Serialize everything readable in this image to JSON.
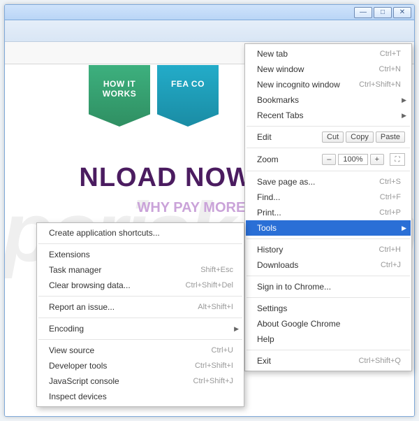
{
  "watermark": "pcrisk.com",
  "ribbons": {
    "how_it_works": "HOW IT\nWORKS",
    "features": "FEA\nCO"
  },
  "hero": {
    "headline": "NLOAD NOW, SAVE",
    "sub": "WHY PAY MORE WHE"
  },
  "main_menu": {
    "new_tab": {
      "label": "New tab",
      "accel": "Ctrl+T"
    },
    "new_window": {
      "label": "New window",
      "accel": "Ctrl+N"
    },
    "new_incognito": {
      "label": "New incognito window",
      "accel": "Ctrl+Shift+N"
    },
    "bookmarks": {
      "label": "Bookmarks"
    },
    "recent_tabs": {
      "label": "Recent Tabs"
    },
    "edit": {
      "label": "Edit",
      "cut": "Cut",
      "copy": "Copy",
      "paste": "Paste"
    },
    "zoom": {
      "label": "Zoom",
      "value": "100%"
    },
    "save_as": {
      "label": "Save page as...",
      "accel": "Ctrl+S"
    },
    "find": {
      "label": "Find...",
      "accel": "Ctrl+F"
    },
    "print": {
      "label": "Print...",
      "accel": "Ctrl+P"
    },
    "tools": {
      "label": "Tools"
    },
    "history": {
      "label": "History",
      "accel": "Ctrl+H"
    },
    "downloads": {
      "label": "Downloads",
      "accel": "Ctrl+J"
    },
    "sign_in": {
      "label": "Sign in to Chrome..."
    },
    "settings": {
      "label": "Settings"
    },
    "about": {
      "label": "About Google Chrome"
    },
    "help": {
      "label": "Help"
    },
    "exit": {
      "label": "Exit",
      "accel": "Ctrl+Shift+Q"
    }
  },
  "tools_menu": {
    "create_shortcuts": {
      "label": "Create application shortcuts..."
    },
    "extensions": {
      "label": "Extensions"
    },
    "task_manager": {
      "label": "Task manager",
      "accel": "Shift+Esc"
    },
    "clear_data": {
      "label": "Clear browsing data...",
      "accel": "Ctrl+Shift+Del"
    },
    "report_issue": {
      "label": "Report an issue...",
      "accel": "Alt+Shift+I"
    },
    "encoding": {
      "label": "Encoding"
    },
    "view_source": {
      "label": "View source",
      "accel": "Ctrl+U"
    },
    "dev_tools": {
      "label": "Developer tools",
      "accel": "Ctrl+Shift+I"
    },
    "js_console": {
      "label": "JavaScript console",
      "accel": "Ctrl+Shift+J"
    },
    "inspect_devices": {
      "label": "Inspect devices"
    }
  }
}
